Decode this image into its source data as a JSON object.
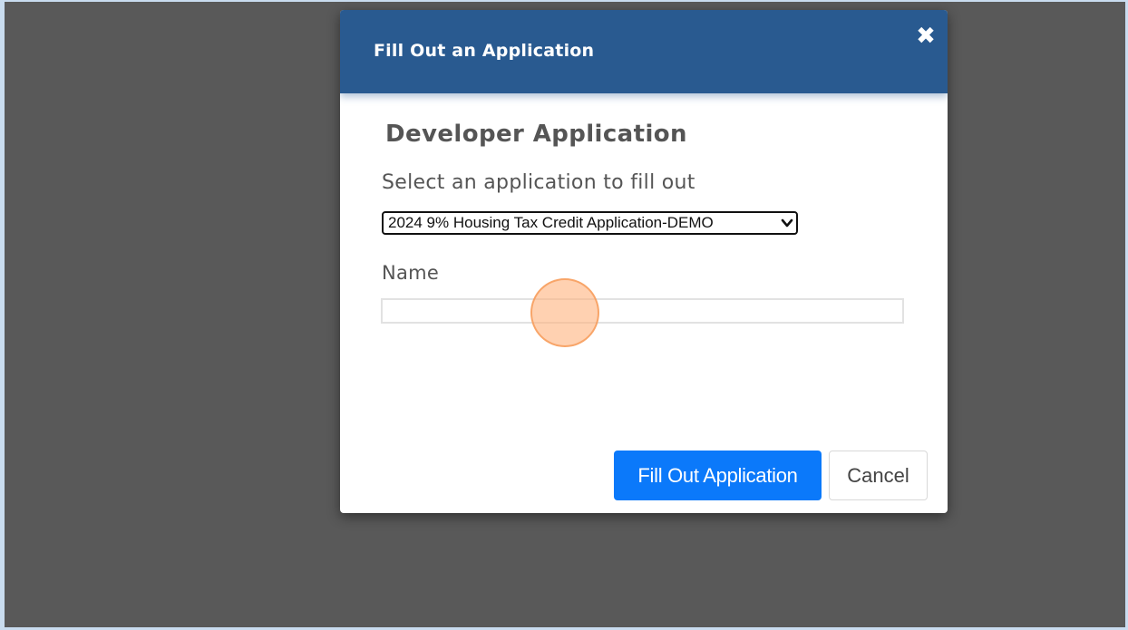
{
  "modal": {
    "title": "Fill Out an Application",
    "close_icon": "close-icon",
    "heading": "Developer Application",
    "select_label": "Select an application to fill out",
    "selected_application": "2024 9% Housing Tax Credit Application-DEMO",
    "name_label": "Name",
    "name_value": "",
    "submit_label": "Fill Out Application",
    "cancel_label": "Cancel"
  },
  "colors": {
    "header": "#295a90",
    "primary_button": "#0b79fa",
    "backdrop": "#595959",
    "click_indicator": "#ffb27d"
  }
}
